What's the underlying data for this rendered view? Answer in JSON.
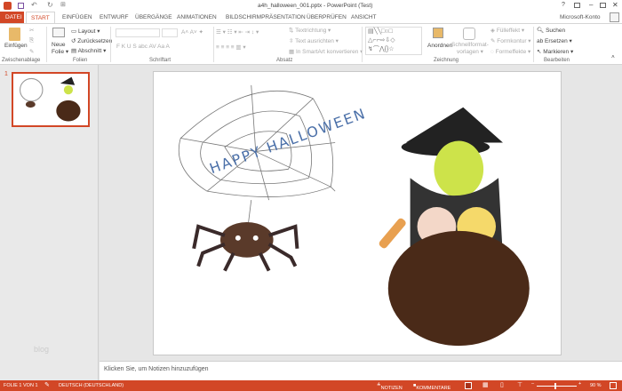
{
  "titlebar": {
    "title": "a4h_halloween_001.pptx - PowerPoint (Test)",
    "help": "?",
    "account": "Microsoft-Konto"
  },
  "tabs": [
    "DATEI",
    "START",
    "EINFÜGEN",
    "ENTWURF",
    "ÜBERGÄNGE",
    "ANIMATIONEN",
    "BILDSCHIRMPRÄSENTATION",
    "ÜBERPRÜFEN",
    "ANSICHT"
  ],
  "ribbon": {
    "clipboard": {
      "paste": "Einfügen",
      "label": "Zwischenablage"
    },
    "slides": {
      "new1": "Neue",
      "new2": "Folie",
      "layout": "Layout",
      "reset": "Zurücksetzen",
      "section": "Abschnitt",
      "label": "Folien"
    },
    "font": {
      "label": "Schriftart",
      "buttons": "F  K  U  S  abc  AV  Aa  A"
    },
    "paragraph": {
      "direction": "Textrichtung",
      "align": "Text ausrichten",
      "smartart": "In SmartArt konvertieren",
      "label": "Absatz"
    },
    "drawing": {
      "arrange": "Anordnen",
      "quick1": "Schnellformat-",
      "quick2": "vorlagen",
      "fill": "Fülleffekt",
      "outline": "Formkontur",
      "effects": "Formeffekte",
      "label": "Zeichnung"
    },
    "editing": {
      "find": "Suchen",
      "replace": "Ersetzen",
      "select": "Markieren",
      "label": "Bearbeiten"
    }
  },
  "thumbnail": {
    "number": "1"
  },
  "slide": {
    "web_text": "HAPPY HALLOWEEN"
  },
  "watermark": "blog",
  "notes": {
    "placeholder": "Klicken Sie, um Notizen hinzuzufügen"
  },
  "status": {
    "slide": "FOLIE 1 VON 1",
    "language": "DEUTSCH (DEUTSCHLAND)",
    "notes": "NOTIZEN",
    "comments": "KOMMENTARE",
    "zoom": "90 %",
    "zoom_value": 90
  },
  "colors": {
    "accent": "#d24726"
  }
}
